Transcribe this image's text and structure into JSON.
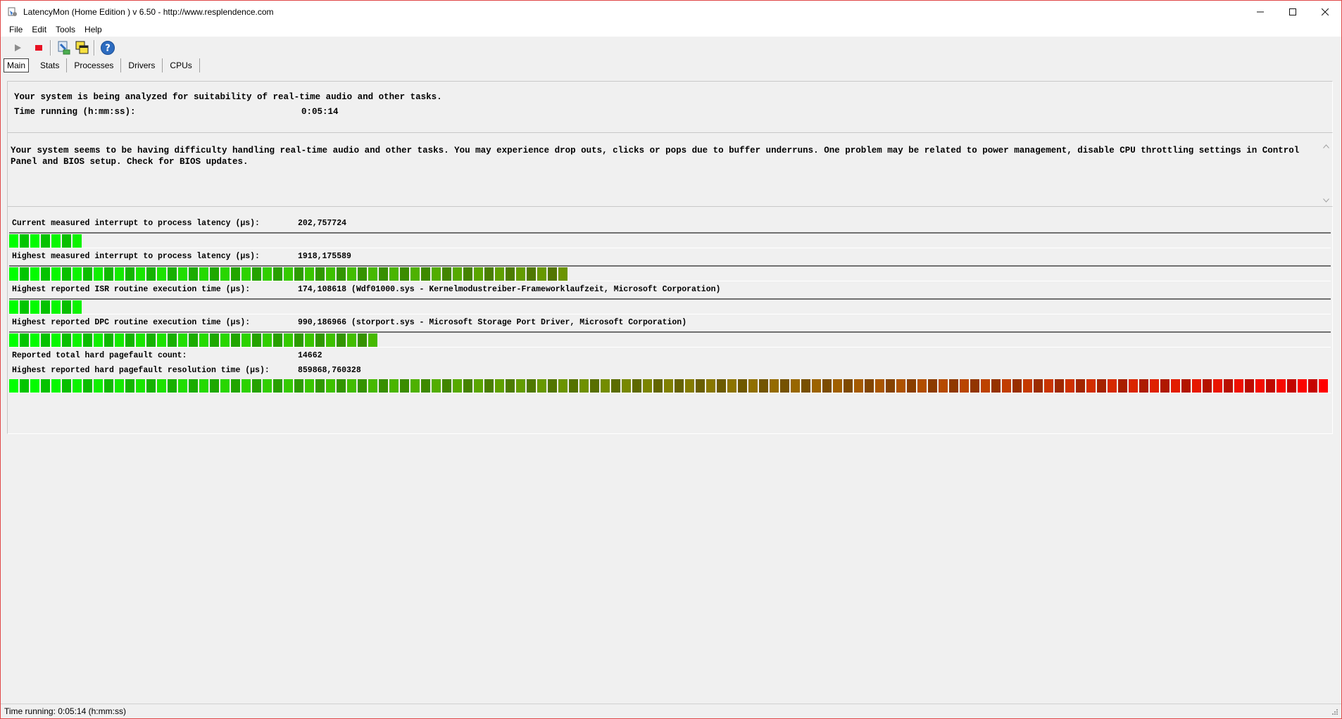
{
  "window": {
    "title": "LatencyMon  (Home Edition )  v 6.50 - http://www.resplendence.com"
  },
  "menu": [
    "File",
    "Edit",
    "Tools",
    "Help"
  ],
  "toolbar": {
    "buttons": [
      "play-icon",
      "stop-icon",
      "hardware-icon",
      "windows-icon",
      "help-icon"
    ]
  },
  "tabs": [
    "Main",
    "Stats",
    "Processes",
    "Drivers",
    "CPUs"
  ],
  "status": {
    "line1": "Your system is being analyzed for suitability of real-time audio and other tasks.",
    "time_label": "Time running (h:mm:ss):",
    "time_value": "0:05:14"
  },
  "message": "Your system seems to be having difficulty handling real-time audio and other tasks. You may experience drop outs, clicks or pops due to buffer underruns. One problem may be related to power management, disable CPU throttling settings in Control Panel and BIOS setup. Check for BIOS updates.",
  "metrics": [
    {
      "label": "Current measured interrupt to process latency (µs):",
      "value": "202,757724",
      "bar_fraction": 0.054
    },
    {
      "label": "Highest measured interrupt to process latency (µs):",
      "value": "1918,175589",
      "bar_fraction": 0.424
    },
    {
      "label": "Highest reported ISR routine execution time (µs):",
      "value": "174,108618  (Wdf01000.sys - Kernelmodustreiber-Frameworklaufzeit, Microsoft Corporation)",
      "bar_fraction": 0.054
    },
    {
      "label": "Highest reported DPC routine execution time (µs):",
      "value": "990,186966  (storport.sys - Microsoft Storage Port Driver, Microsoft Corporation)",
      "bar_fraction": 0.279
    },
    {
      "label": "Reported total hard pagefault count:",
      "value": "14662"
    },
    {
      "label": "Highest reported hard pagefault resolution time (µs):",
      "value": "859868,760328",
      "bar_fraction": 1.0
    }
  ],
  "statusbar": {
    "text": "Time running: 0:05:14  (h:mm:ss)"
  },
  "colors": {
    "bar_low": "#00ff00",
    "bar_high": "#ff0000",
    "stop_red": "#e81123"
  }
}
